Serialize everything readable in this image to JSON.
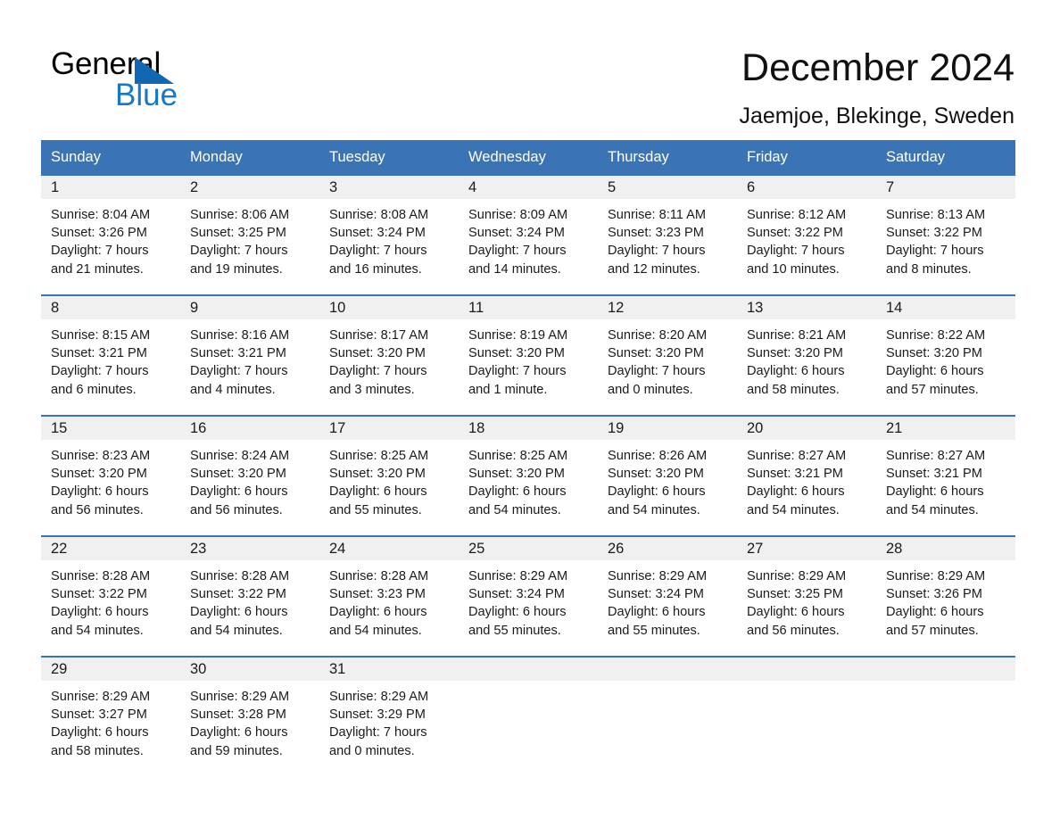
{
  "logo": {
    "text_top": "General",
    "text_bottom": "Blue",
    "triangle_color": "#1167b1",
    "blue_color": "#1878c8"
  },
  "header": {
    "title": "December 2024",
    "subtitle": "Jaemjoe, Blekinge, Sweden"
  },
  "theme": {
    "header_blue": "#3b74b4",
    "daynum_gray": "#f0f0f0",
    "text": "#1b1b1b",
    "page_background": "#ffffff"
  },
  "calendar": {
    "weekday_headers": [
      "Sunday",
      "Monday",
      "Tuesday",
      "Wednesday",
      "Thursday",
      "Friday",
      "Saturday"
    ],
    "weeks": [
      [
        {
          "day": "1",
          "sunrise": "Sunrise: 8:04 AM",
          "sunset": "Sunset: 3:26 PM",
          "daylight_line1": "Daylight: 7 hours",
          "daylight_line2": "and 21 minutes."
        },
        {
          "day": "2",
          "sunrise": "Sunrise: 8:06 AM",
          "sunset": "Sunset: 3:25 PM",
          "daylight_line1": "Daylight: 7 hours",
          "daylight_line2": "and 19 minutes."
        },
        {
          "day": "3",
          "sunrise": "Sunrise: 8:08 AM",
          "sunset": "Sunset: 3:24 PM",
          "daylight_line1": "Daylight: 7 hours",
          "daylight_line2": "and 16 minutes."
        },
        {
          "day": "4",
          "sunrise": "Sunrise: 8:09 AM",
          "sunset": "Sunset: 3:24 PM",
          "daylight_line1": "Daylight: 7 hours",
          "daylight_line2": "and 14 minutes."
        },
        {
          "day": "5",
          "sunrise": "Sunrise: 8:11 AM",
          "sunset": "Sunset: 3:23 PM",
          "daylight_line1": "Daylight: 7 hours",
          "daylight_line2": "and 12 minutes."
        },
        {
          "day": "6",
          "sunrise": "Sunrise: 8:12 AM",
          "sunset": "Sunset: 3:22 PM",
          "daylight_line1": "Daylight: 7 hours",
          "daylight_line2": "and 10 minutes."
        },
        {
          "day": "7",
          "sunrise": "Sunrise: 8:13 AM",
          "sunset": "Sunset: 3:22 PM",
          "daylight_line1": "Daylight: 7 hours",
          "daylight_line2": "and 8 minutes."
        }
      ],
      [
        {
          "day": "8",
          "sunrise": "Sunrise: 8:15 AM",
          "sunset": "Sunset: 3:21 PM",
          "daylight_line1": "Daylight: 7 hours",
          "daylight_line2": "and 6 minutes."
        },
        {
          "day": "9",
          "sunrise": "Sunrise: 8:16 AM",
          "sunset": "Sunset: 3:21 PM",
          "daylight_line1": "Daylight: 7 hours",
          "daylight_line2": "and 4 minutes."
        },
        {
          "day": "10",
          "sunrise": "Sunrise: 8:17 AM",
          "sunset": "Sunset: 3:20 PM",
          "daylight_line1": "Daylight: 7 hours",
          "daylight_line2": "and 3 minutes."
        },
        {
          "day": "11",
          "sunrise": "Sunrise: 8:19 AM",
          "sunset": "Sunset: 3:20 PM",
          "daylight_line1": "Daylight: 7 hours",
          "daylight_line2": "and 1 minute."
        },
        {
          "day": "12",
          "sunrise": "Sunrise: 8:20 AM",
          "sunset": "Sunset: 3:20 PM",
          "daylight_line1": "Daylight: 7 hours",
          "daylight_line2": "and 0 minutes."
        },
        {
          "day": "13",
          "sunrise": "Sunrise: 8:21 AM",
          "sunset": "Sunset: 3:20 PM",
          "daylight_line1": "Daylight: 6 hours",
          "daylight_line2": "and 58 minutes."
        },
        {
          "day": "14",
          "sunrise": "Sunrise: 8:22 AM",
          "sunset": "Sunset: 3:20 PM",
          "daylight_line1": "Daylight: 6 hours",
          "daylight_line2": "and 57 minutes."
        }
      ],
      [
        {
          "day": "15",
          "sunrise": "Sunrise: 8:23 AM",
          "sunset": "Sunset: 3:20 PM",
          "daylight_line1": "Daylight: 6 hours",
          "daylight_line2": "and 56 minutes."
        },
        {
          "day": "16",
          "sunrise": "Sunrise: 8:24 AM",
          "sunset": "Sunset: 3:20 PM",
          "daylight_line1": "Daylight: 6 hours",
          "daylight_line2": "and 56 minutes."
        },
        {
          "day": "17",
          "sunrise": "Sunrise: 8:25 AM",
          "sunset": "Sunset: 3:20 PM",
          "daylight_line1": "Daylight: 6 hours",
          "daylight_line2": "and 55 minutes."
        },
        {
          "day": "18",
          "sunrise": "Sunrise: 8:25 AM",
          "sunset": "Sunset: 3:20 PM",
          "daylight_line1": "Daylight: 6 hours",
          "daylight_line2": "and 54 minutes."
        },
        {
          "day": "19",
          "sunrise": "Sunrise: 8:26 AM",
          "sunset": "Sunset: 3:20 PM",
          "daylight_line1": "Daylight: 6 hours",
          "daylight_line2": "and 54 minutes."
        },
        {
          "day": "20",
          "sunrise": "Sunrise: 8:27 AM",
          "sunset": "Sunset: 3:21 PM",
          "daylight_line1": "Daylight: 6 hours",
          "daylight_line2": "and 54 minutes."
        },
        {
          "day": "21",
          "sunrise": "Sunrise: 8:27 AM",
          "sunset": "Sunset: 3:21 PM",
          "daylight_line1": "Daylight: 6 hours",
          "daylight_line2": "and 54 minutes."
        }
      ],
      [
        {
          "day": "22",
          "sunrise": "Sunrise: 8:28 AM",
          "sunset": "Sunset: 3:22 PM",
          "daylight_line1": "Daylight: 6 hours",
          "daylight_line2": "and 54 minutes."
        },
        {
          "day": "23",
          "sunrise": "Sunrise: 8:28 AM",
          "sunset": "Sunset: 3:22 PM",
          "daylight_line1": "Daylight: 6 hours",
          "daylight_line2": "and 54 minutes."
        },
        {
          "day": "24",
          "sunrise": "Sunrise: 8:28 AM",
          "sunset": "Sunset: 3:23 PM",
          "daylight_line1": "Daylight: 6 hours",
          "daylight_line2": "and 54 minutes."
        },
        {
          "day": "25",
          "sunrise": "Sunrise: 8:29 AM",
          "sunset": "Sunset: 3:24 PM",
          "daylight_line1": "Daylight: 6 hours",
          "daylight_line2": "and 55 minutes."
        },
        {
          "day": "26",
          "sunrise": "Sunrise: 8:29 AM",
          "sunset": "Sunset: 3:24 PM",
          "daylight_line1": "Daylight: 6 hours",
          "daylight_line2": "and 55 minutes."
        },
        {
          "day": "27",
          "sunrise": "Sunrise: 8:29 AM",
          "sunset": "Sunset: 3:25 PM",
          "daylight_line1": "Daylight: 6 hours",
          "daylight_line2": "and 56 minutes."
        },
        {
          "day": "28",
          "sunrise": "Sunrise: 8:29 AM",
          "sunset": "Sunset: 3:26 PM",
          "daylight_line1": "Daylight: 6 hours",
          "daylight_line2": "and 57 minutes."
        }
      ],
      [
        {
          "day": "29",
          "sunrise": "Sunrise: 8:29 AM",
          "sunset": "Sunset: 3:27 PM",
          "daylight_line1": "Daylight: 6 hours",
          "daylight_line2": "and 58 minutes."
        },
        {
          "day": "30",
          "sunrise": "Sunrise: 8:29 AM",
          "sunset": "Sunset: 3:28 PM",
          "daylight_line1": "Daylight: 6 hours",
          "daylight_line2": "and 59 minutes."
        },
        {
          "day": "31",
          "sunrise": "Sunrise: 8:29 AM",
          "sunset": "Sunset: 3:29 PM",
          "daylight_line1": "Daylight: 7 hours",
          "daylight_line2": "and 0 minutes."
        },
        {
          "day": "",
          "sunrise": "",
          "sunset": "",
          "daylight_line1": "",
          "daylight_line2": ""
        },
        {
          "day": "",
          "sunrise": "",
          "sunset": "",
          "daylight_line1": "",
          "daylight_line2": ""
        },
        {
          "day": "",
          "sunrise": "",
          "sunset": "",
          "daylight_line1": "",
          "daylight_line2": ""
        },
        {
          "day": "",
          "sunrise": "",
          "sunset": "",
          "daylight_line1": "",
          "daylight_line2": ""
        }
      ]
    ]
  }
}
